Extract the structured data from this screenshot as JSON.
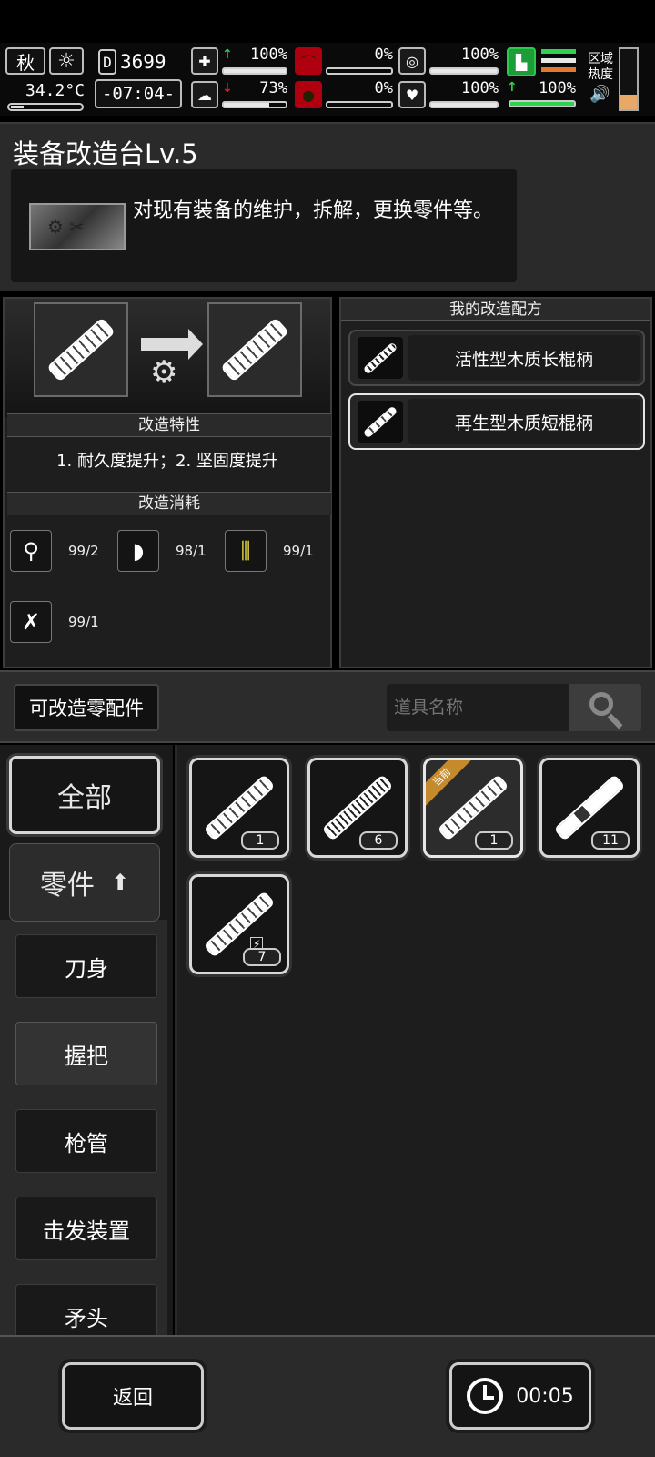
{
  "hud": {
    "season": "秋",
    "weather_icon": "sun-icon",
    "temperature": "34.2°C",
    "day_label": "D",
    "day": "3699",
    "time": "-07:04-",
    "health_pct": "100%",
    "stomach_pct": "0%",
    "mind_pct": "100%",
    "stamina_pct": "100%",
    "brain_pct": "73%",
    "blood_pct": "0%",
    "heart_pct": "100%",
    "region_label": "区域热度",
    "heat_level": 0.25,
    "colors": {
      "green": "#2ed24e",
      "red": "#b00010",
      "heat": "#e8a868"
    }
  },
  "station": {
    "title": "装备改造台Lv.5",
    "description": "对现有装备的维护，拆解，更换零件等。"
  },
  "craft": {
    "traits_header": "改造特性",
    "traits": "1. 耐久度提升；2. 坚固度提升",
    "cost_header": "改造消耗",
    "costs": [
      {
        "icon": "handle-icon",
        "amount": "99/2"
      },
      {
        "icon": "wood-chips-icon",
        "amount": "98/1"
      },
      {
        "icon": "fiber-icon",
        "amount": "99/1"
      },
      {
        "icon": "tool-icon",
        "amount": "99/1"
      }
    ]
  },
  "recipes": {
    "header": "我的改造配方",
    "items": [
      {
        "label": "活性型木质长棍柄",
        "selected": false
      },
      {
        "label": "再生型木质短棍柄",
        "selected": true
      }
    ]
  },
  "inventory": {
    "filter_label": "可改造零配件",
    "search_placeholder": "道具名称",
    "categories": {
      "all": "全部",
      "parts": "零件",
      "sub": [
        "刀身",
        "握把",
        "枪管",
        "击发装置",
        "矛头"
      ]
    },
    "items": [
      {
        "count": "1"
      },
      {
        "count": "6"
      },
      {
        "count": "1",
        "badge": "当前"
      },
      {
        "count": "11"
      },
      {
        "count": "7"
      }
    ]
  },
  "footer": {
    "back": "返回",
    "timer": "00:05"
  }
}
